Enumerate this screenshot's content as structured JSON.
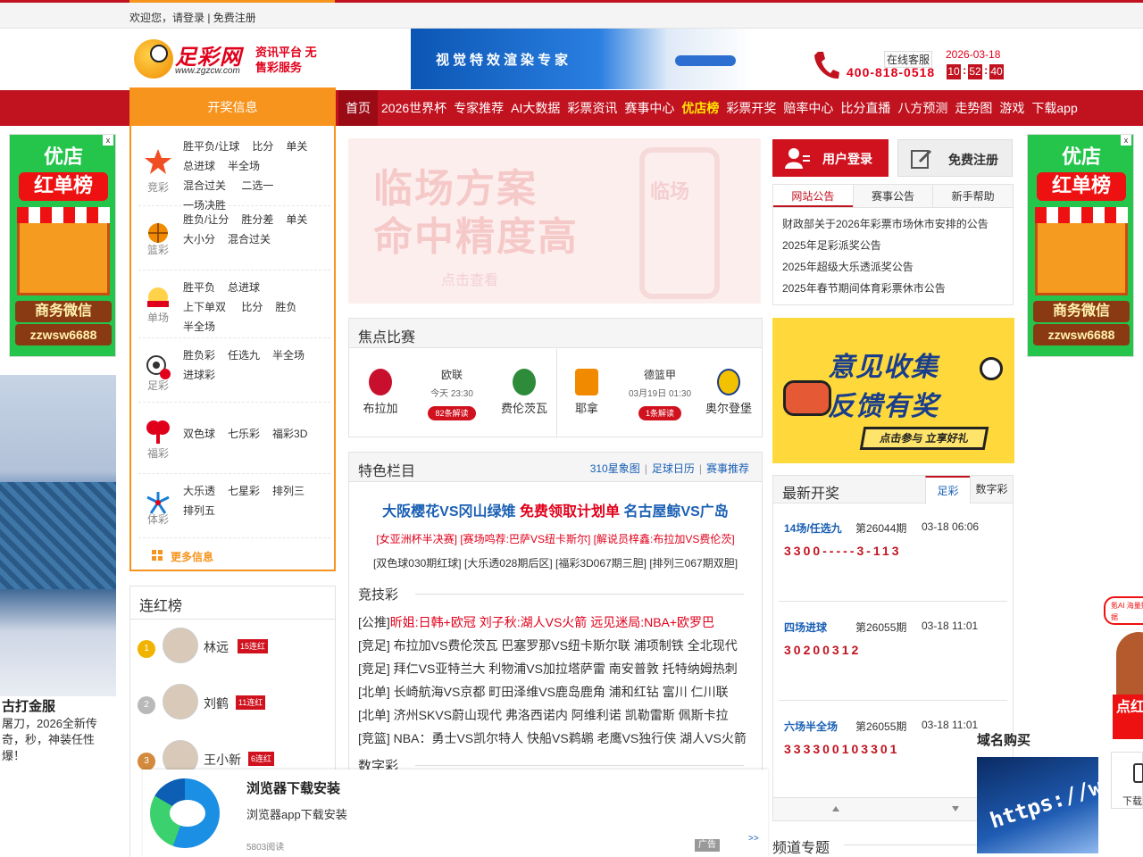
{
  "topbar": {
    "text": "欢迎您，请登录 | 免费注册"
  },
  "logo": {
    "brand": "足彩网",
    "domain": "www.zgzcw.com",
    "tagline": "资讯平台 无售彩服务"
  },
  "banner": {
    "text": "视觉特效渲染专家"
  },
  "contact": {
    "service_label": "在线客服",
    "phone": "400-818-0518",
    "date": "2026-03-18",
    "clock": [
      "10",
      "52",
      "40"
    ]
  },
  "nav": {
    "side_label": "开奖信息",
    "items": [
      "首页",
      "2026世界杯",
      "专家推荐",
      "AI大数据",
      "彩票资讯",
      "赛事中心",
      "优店榜",
      "彩票开奖",
      "赔率中心",
      "比分直播",
      "八方预测",
      "走势图",
      "游戏",
      "下载app"
    ]
  },
  "lottery_groups": [
    {
      "caption": "竞彩",
      "links": [
        "胜平负/让球",
        "比分",
        "单关",
        "总进球",
        "半全场",
        "混合过关",
        "二选一",
        "一场决胜"
      ]
    },
    {
      "caption": "篮彩",
      "links": [
        "胜负/让分",
        "胜分差",
        "单关",
        "大小分",
        "混合过关"
      ]
    },
    {
      "caption": "单场",
      "links": [
        "胜平负",
        "总进球",
        "上下单双",
        "比分",
        "胜负",
        "半全场"
      ]
    },
    {
      "caption": "足彩",
      "links": [
        "胜负彩",
        "任选九",
        "半全场",
        "进球彩"
      ]
    },
    {
      "caption": "福彩",
      "links": [
        "双色球",
        "七乐彩",
        "福彩3D"
      ]
    },
    {
      "caption": "体彩",
      "links": [
        "大乐透",
        "七星彩",
        "排列三",
        "排列五"
      ]
    }
  ],
  "more_info": "更多信息",
  "hero": {
    "line1": "临场方案",
    "line2": "命中精度高",
    "cta": "点击查看",
    "phone_text": "临场"
  },
  "focus": {
    "title": "焦点比赛",
    "matches": [
      {
        "home": "布拉加",
        "away": "费伦茨瓦",
        "league": "欧联",
        "time": "今天 23:30",
        "btn": "82条解读"
      },
      {
        "home": "耶拿",
        "away": "奥尔登堡",
        "league": "德篮甲",
        "time": "03月19日 01:30",
        "btn": "1条解读"
      }
    ]
  },
  "feature": {
    "title": "特色栏目",
    "links": [
      "310星象图",
      "足球日历",
      "赛事推荐"
    ],
    "headline": {
      "a": "大阪樱花VS冈山绿雉",
      "b": "免费领取计划单",
      "c": "名古屋鲸VS广岛"
    },
    "row2": "[女亚洲杯半决赛] [赛场鸣荐:巴萨VS纽卡斯尔] [解说员梓鑫:布拉加VS费伦茨]",
    "row3": "[双色球030期红球] [大乐透028期后区] [福彩3D067期三胆] [排列三067期双胆]",
    "sec1": "竞技彩",
    "feeds": [
      {
        "tag": "[公推]",
        "text": "昕姐:日韩+欧冠 刘子秋:湖人VS火箭 远见迷局:NBA+欧罗巴",
        "red": true
      },
      {
        "tag": "[竞足]",
        "text": "布拉加VS费伦茨瓦 巴塞罗那VS纽卡斯尔联 浦项制铁 全北现代",
        "red": false
      },
      {
        "tag": "[竞足]",
        "text": "拜仁VS亚特兰大 利物浦VS加拉塔萨雷 南安普敦 托特纳姆热刺",
        "red": false
      },
      {
        "tag": "[北单]",
        "text": "长崎航海VS京都 町田泽维VS鹿岛鹿角 浦和红钻 富川 仁川联",
        "red": false
      },
      {
        "tag": "[北单]",
        "text": "济州SKVS蔚山现代 弗洛西诺内 阿维利诺 凯勒雷斯 佩斯卡拉",
        "red": false
      },
      {
        "tag": "[竞篮]",
        "text": "NBA：勇士VS凯尔特人 快船VS鹈鹕 老鹰VS独行侠 湖人VS火箭",
        "red": false
      }
    ],
    "sec2": "数字彩"
  },
  "account": {
    "login": "用户登录",
    "register": "免费注册"
  },
  "notice": {
    "tabs": [
      "网站公告",
      "赛事公告",
      "新手帮助"
    ],
    "items": [
      "财政部关于2026年彩票市场休市安排的公告",
      "2025年足彩派奖公告",
      "2025年超级大乐透派奖公告",
      "2025年春节期间体育彩票休市公告"
    ]
  },
  "survey": {
    "line1": "意见收集",
    "line2": "反馈有奖",
    "cta": "点击参与 立享好礼"
  },
  "draws": {
    "title": "最新开奖",
    "tabs": [
      "足彩",
      "数字彩"
    ],
    "items": [
      {
        "name": "14场/任选九",
        "issue": "第26044期",
        "time": "03-18 06:06",
        "result": "3300-----3-113"
      },
      {
        "name": "四场进球",
        "issue": "第26055期",
        "time": "03-18 11:01",
        "result": "30200312"
      },
      {
        "name": "六场半全场",
        "issue": "第26055期",
        "time": "03-18 11:01",
        "result": "333300103301"
      }
    ]
  },
  "channel": "频道专题",
  "streak": {
    "title": "连红榜",
    "rows": [
      {
        "rank": "1",
        "name": "林远",
        "badge": "15连红",
        "medal_color": "#f0b400"
      },
      {
        "rank": "2",
        "name": "刘鹤",
        "badge": "11连红",
        "medal_color": "#b9b9b9"
      },
      {
        "rank": "3",
        "name": "王小新",
        "badge": "6连红",
        "medal_color": "#d38a3c"
      }
    ]
  },
  "side_ad": {
    "line1": "优店",
    "line2": "红单榜",
    "line3": "商务微信",
    "line4": "zzwsw6688",
    "close": "x"
  },
  "game_ad": {
    "title": "古打金服",
    "desc": "屠刀，2026全新传奇，秒，神装任性爆！"
  },
  "browser_ad": {
    "title": "浏览器下载安装",
    "desc": "浏览器app下载安装",
    "reads": "5803阅读",
    "tag": "广告",
    "more": ">>"
  },
  "domain_ad": {
    "title": "域名购买",
    "text": "https://ww"
  },
  "download_tab": {
    "label": "下载"
  },
  "cartoon_ad": {
    "bubble": "氪AI 海量数据",
    "card": "点红"
  }
}
